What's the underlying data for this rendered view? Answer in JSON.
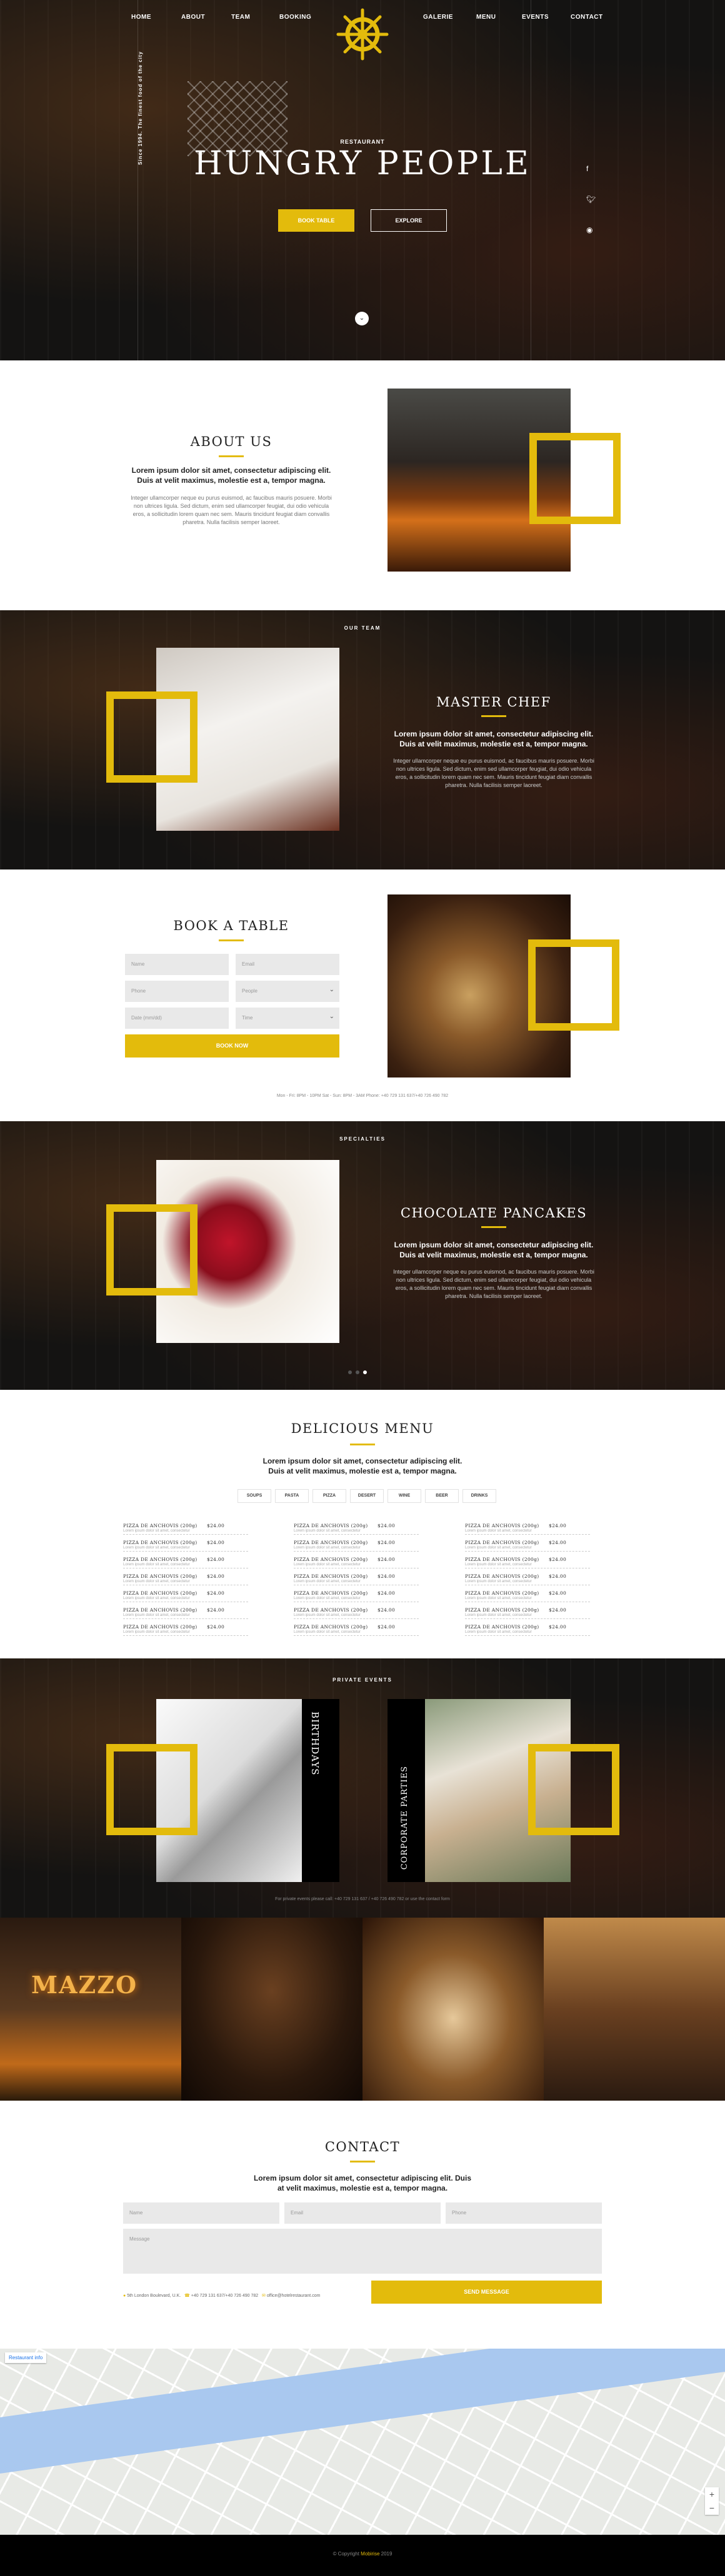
{
  "nav": {
    "items": [
      "HOME",
      "ABOUT",
      "TEAM",
      "BOOKING",
      "GALERIE",
      "MENU",
      "EVENTS",
      "CONTACT"
    ]
  },
  "hero": {
    "subtitle": "RESTAURANT",
    "title": "HUNGRY PEOPLE",
    "vertical_text": "Since 1994. The finest food of the city",
    "btn_book": "BOOK TABLE",
    "btn_explore": "EXPLORE",
    "social": [
      "facebook-icon",
      "twitter-icon",
      "instagram-icon"
    ]
  },
  "about": {
    "title": "ABOUT US",
    "lead": "Lorem ipsum dolor sit amet, consectetur adipiscing elit. Duis at velit maximus, molestie est a, tempor magna.",
    "body": "Integer ullamcorper neque eu purus euismod, ac faucibus mauris posuere. Morbi non ultrices ligula. Sed dictum, enim sed ullamcorper feugiat, dui odio vehicula eros, a sollicitudin lorem quam nec sem. Mauris tincidunt feugiat diam convallis pharetra. Nulla facilisis semper laoreet."
  },
  "team": {
    "label": "OUR TEAM",
    "title": "MASTER CHEF",
    "lead": "Lorem ipsum dolor sit amet, consectetur adipiscing elit. Duis at velit maximus, molestie est a, tempor magna.",
    "body": "Integer ullamcorper neque eu purus euismod, ac faucibus mauris posuere. Morbi non ultrices ligula. Sed dictum, enim sed ullamcorper feugiat, dui odio vehicula eros, a sollicitudin lorem quam nec sem. Mauris tincidunt feugiat diam convallis pharetra. Nulla facilisis semper laoreet."
  },
  "booking": {
    "title": "BOOK A TABLE",
    "fields": {
      "name": "Name",
      "email": "Email",
      "phone": "Phone",
      "people": "People",
      "date": "Date (mm/dd)",
      "time": "Time"
    },
    "button": "BOOK NOW",
    "info": "Mon - Fri: 8PM - 10PM  Sat - Sun: 8PM - 3AM  Phone: +40 729 131 637/+40 726 490 782"
  },
  "specialties": {
    "label": "SPECIALTIES",
    "title": "CHOCOLATE PANCAKES",
    "lead": "Lorem ipsum dolor sit amet, consectetur adipiscing elit. Duis at velit maximus, molestie est a, tempor magna.",
    "body": "Integer ullamcorper neque eu purus euismod, ac faucibus mauris posuere. Morbi non ultrices ligula. Sed dictum, enim sed ullamcorper feugiat, dui odio vehicula eros, a sollicitudin lorem quam nec sem. Mauris tincidunt feugiat diam convallis pharetra. Nulla facilisis semper laoreet."
  },
  "menu": {
    "title": "DELICIOUS MENU",
    "lead": "Lorem ipsum dolor sit amet, consectetur adipiscing elit. Duis at velit maximus, molestie est a, tempor magna.",
    "tabs": [
      "SOUPS",
      "PASTA",
      "PIZZA",
      "DESERT",
      "WINE",
      "BEER",
      "DRINKS"
    ],
    "item_name": "PIZZA DE ANCHOVIS (200g)",
    "item_price": "$24.00",
    "item_desc": "Lorem ipsum dolor sit amet, consectetur"
  },
  "events": {
    "label": "PRIVATE EVENTS",
    "birthdays": "BIRTHDAYS",
    "corporate": "CORPORATE PARTIES",
    "info": "For private events please call: +40 729 131 637 / +40 726 490 782 or use the contact form"
  },
  "contact": {
    "title": "CONTACT",
    "lead": "Lorem ipsum dolor sit amet, consectetur adipiscing elit. Duis at velit maximus, molestie est a, tempor magna.",
    "fields": {
      "name": "Name",
      "email": "Email",
      "phone": "Phone",
      "message": "Message"
    },
    "address": "5th London Boulevard, U.K.",
    "phone": "+40 729 131 637/+40 726 490 782",
    "email": "office@hotelrestaurant.com",
    "button": "SEND MESSAGE"
  },
  "gallery": {
    "sign": "MAZZO"
  },
  "map": {
    "label": "Restaurant info"
  },
  "footer": {
    "prefix": "© Copyright",
    "brand": "Mobirise",
    "year": "2019"
  },
  "colors": {
    "accent": "#e3bb0c",
    "dark": "#141312"
  }
}
